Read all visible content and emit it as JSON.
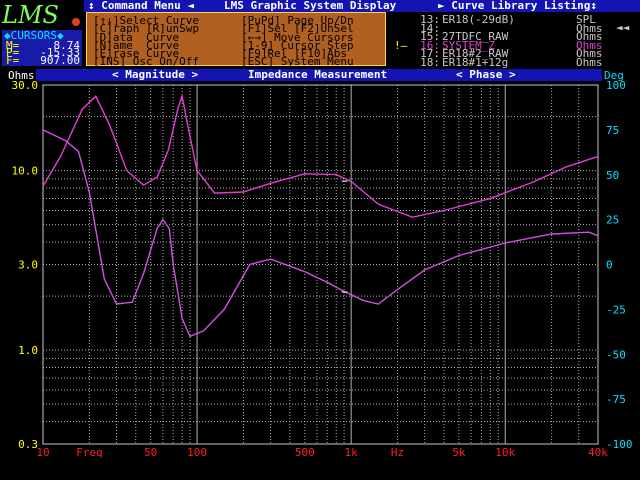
{
  "app": {
    "logo_text": "LMS",
    "title_segments": [
      "↕ Command Menu ◄",
      "LMS Graphic System Display",
      "► Curve Library Listing↕"
    ]
  },
  "cursors": {
    "title": "◆CURSORS◆",
    "rows": [
      {
        "label": "M=",
        "value": "8.74"
      },
      {
        "label": "P=",
        "value": "-15.33"
      },
      {
        "label": "F=",
        "value": "907.00"
      }
    ]
  },
  "command_menu": {
    "left": [
      "[↑↓]Select Curve",
      "[C]raph [R]unSwp",
      "[D]ata  Curve",
      "[N]ame  Curve",
      "[E]rase Curve",
      "[INS] Osc On/Off"
    ],
    "right": [
      "[PuPd] Page Up/Dn",
      "[F1]Sel [F2]UnSel",
      "[←→] Move Cursors",
      "[1-9] Cursor Step",
      "[F9]Rel [F10]Abs",
      "[ESC] System Menu"
    ]
  },
  "curve_library": [
    {
      "num": "13:",
      "name": "ER18(-29dB)",
      "unit": "SPL",
      "selected": false
    },
    {
      "num": "14:",
      "name": "",
      "unit": "Ohms",
      "selected": false
    },
    {
      "num": "15:",
      "name": "27TDFC_RAW",
      "unit": "Ohms",
      "selected": false
    },
    {
      "num": "16:",
      "name": "SYSTEM_Z",
      "unit": "Ohms",
      "selected": true
    },
    {
      "num": "17:",
      "name": "ER18#2_RAW",
      "unit": "Ohms",
      "selected": false
    },
    {
      "num": "18:",
      "name": "ER18#1+12g",
      "unit": "Ohms",
      "selected": false
    }
  ],
  "chart_header": {
    "left_unit": "Ohms",
    "magnitude": "< Magnitude >",
    "title": "Impedance Measurement",
    "phase": "< Phase >",
    "right_unit": "Deg"
  },
  "chart_data": {
    "type": "line",
    "title": "Impedance Measurement",
    "x_log": true,
    "x_range": [
      10,
      40000
    ],
    "x_tick_labels": [
      {
        "f": 10,
        "label": "10"
      },
      {
        "f": 20,
        "label": "Freq"
      },
      {
        "f": 50,
        "label": "50"
      },
      {
        "f": 100,
        "label": "100"
      },
      {
        "f": 500,
        "label": "500"
      },
      {
        "f": 1000,
        "label": "1k"
      },
      {
        "f": 2000,
        "label": "Hz"
      },
      {
        "f": 5000,
        "label": "5k"
      },
      {
        "f": 10000,
        "label": "10k"
      },
      {
        "f": 40000,
        "label": "40k"
      }
    ],
    "y_left": {
      "unit": "Ohms",
      "log": true,
      "range": [
        0.3,
        30
      ],
      "ticks": [
        "30.0",
        "10.0",
        "3.0",
        "1.0",
        "0.3"
      ]
    },
    "y_right": {
      "unit": "Deg",
      "range": [
        -100,
        100
      ],
      "ticks": [
        "100",
        "75",
        "50",
        "25",
        "0",
        "-25",
        "-50",
        "-75",
        "-100"
      ]
    },
    "series": [
      {
        "axis": "left",
        "points": [
          [
            10,
            8.2
          ],
          [
            13,
            12
          ],
          [
            18,
            22
          ],
          [
            22,
            26
          ],
          [
            27,
            18
          ],
          [
            35,
            10
          ],
          [
            45,
            8.3
          ],
          [
            55,
            9.2
          ],
          [
            65,
            13
          ],
          [
            75,
            22
          ],
          [
            80,
            26
          ],
          [
            88,
            17
          ],
          [
            100,
            10
          ],
          [
            130,
            7.5
          ],
          [
            200,
            7.6
          ],
          [
            300,
            8.5
          ],
          [
            500,
            9.6
          ],
          [
            800,
            9.5
          ],
          [
            1000,
            8.7
          ],
          [
            1500,
            6.5
          ],
          [
            2500,
            5.5
          ],
          [
            4000,
            6.0
          ],
          [
            8000,
            7.0
          ],
          [
            15000,
            8.6
          ],
          [
            25000,
            10.5
          ],
          [
            40000,
            12
          ]
        ]
      },
      {
        "axis": "right",
        "points": [
          [
            10,
            75
          ],
          [
            14,
            69
          ],
          [
            17,
            63
          ],
          [
            20,
            40
          ],
          [
            25,
            -8
          ],
          [
            30,
            -22
          ],
          [
            38,
            -21
          ],
          [
            45,
            -5
          ],
          [
            55,
            20
          ],
          [
            60,
            25
          ],
          [
            66,
            20
          ],
          [
            70,
            0
          ],
          [
            80,
            -30
          ],
          [
            90,
            -40
          ],
          [
            110,
            -37
          ],
          [
            150,
            -25
          ],
          [
            220,
            0
          ],
          [
            300,
            3
          ],
          [
            500,
            -4
          ],
          [
            700,
            -10
          ],
          [
            900,
            -15
          ],
          [
            1200,
            -20
          ],
          [
            1500,
            -22
          ],
          [
            2000,
            -14
          ],
          [
            3000,
            -3
          ],
          [
            5000,
            5
          ],
          [
            10000,
            12
          ],
          [
            20000,
            17
          ],
          [
            35000,
            18
          ],
          [
            40000,
            16
          ]
        ]
      }
    ],
    "cursor": {
      "f": 907,
      "magnitude": 8.74,
      "phase": -15.33
    },
    "grid": true
  },
  "colors": {
    "magnitude_curve": "#e040d0",
    "phase_curve": "#d050e0",
    "grid": "#b0b0b0",
    "menu_bg": "#b06020",
    "bar_bg": "#1414b4"
  }
}
